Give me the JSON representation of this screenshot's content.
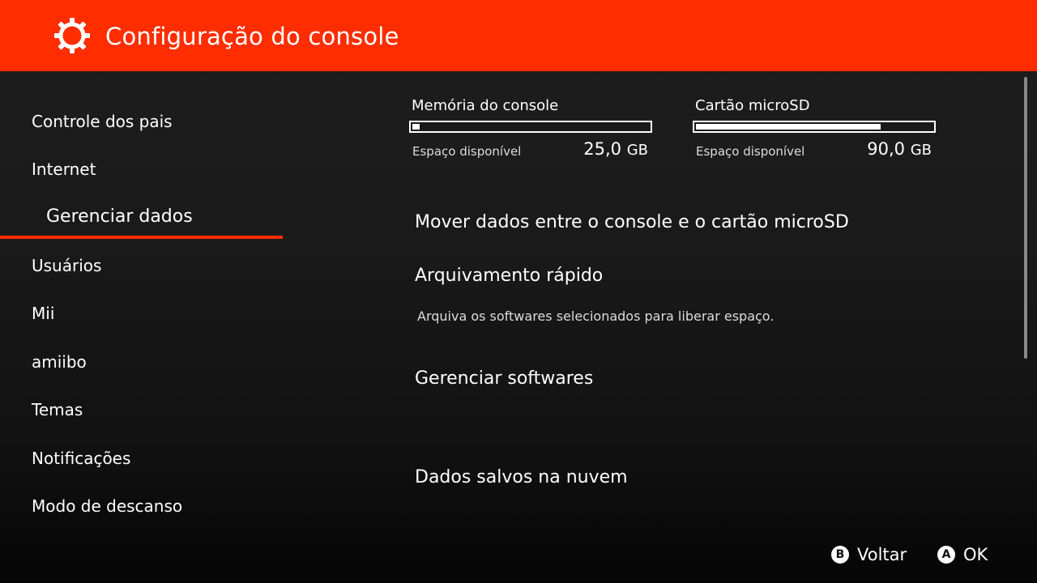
{
  "header": {
    "title": "Configuração do console",
    "icon": "gear-icon",
    "color": "#ff2d00"
  },
  "sidebar": {
    "items": [
      {
        "label": "Controle dos pais"
      },
      {
        "label": "Internet"
      },
      {
        "label": "Gerenciar dados",
        "selected": true
      },
      {
        "label": "Usuários"
      },
      {
        "label": "Mii"
      },
      {
        "label": "amiibo"
      },
      {
        "label": "Temas"
      },
      {
        "label": "Notificações"
      },
      {
        "label": "Modo de descanso"
      }
    ]
  },
  "storage": {
    "console": {
      "title": "Memória do console",
      "available_label": "Espaço disponível",
      "value": "25,0",
      "unit": "GB",
      "used_fraction": 0.03
    },
    "microsd": {
      "title": "Cartão microSD",
      "available_label": "Espaço disponível",
      "value": "90,0",
      "unit": "GB",
      "used_fraction": 0.78
    }
  },
  "main": {
    "move_data": "Mover dados entre o console e o cartão microSD",
    "archive": "Arquivamento rápido",
    "archive_desc": "Arquiva os softwares selecionados para liberar espaço.",
    "manage_software": "Gerenciar softwares",
    "cloud_saves": "Dados salvos na nuvem"
  },
  "footer": {
    "back": {
      "glyph": "B",
      "label": "Voltar"
    },
    "ok": {
      "glyph": "A",
      "label": "OK"
    }
  }
}
